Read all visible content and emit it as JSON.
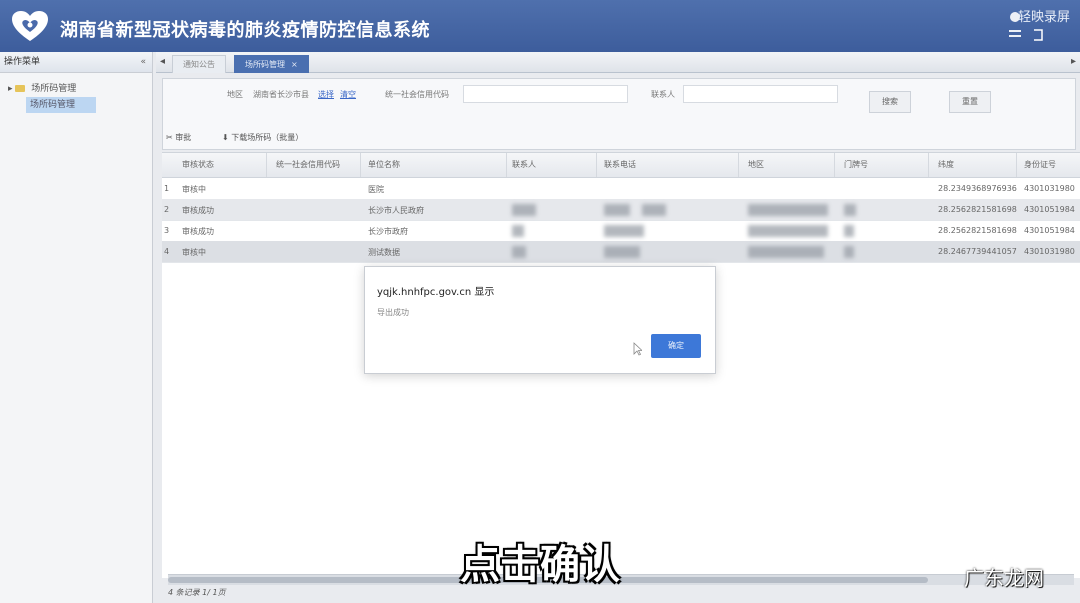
{
  "header": {
    "title": "湖南省新型冠状病毒的肺炎疫情防控信息系统",
    "recorder_text": "轻映录屏"
  },
  "sidebar": {
    "title": "操作菜单",
    "collapse": "«",
    "tree": {
      "parent": "场所码管理",
      "child": "场所码管理"
    }
  },
  "tabs": [
    {
      "label": "通知公告"
    },
    {
      "label": "场所码管理",
      "close": "×"
    }
  ],
  "tab_arrows": {
    "left": "◂",
    "right": "▸"
  },
  "filters": {
    "region_label": "地区",
    "region_value": "湖南省长沙市县",
    "select_link": "选择",
    "clear_link": "清空",
    "credit_code_label": "统一社会信用代码",
    "contact_label": "联系人",
    "search_button": "搜索",
    "reset_button": "重置"
  },
  "toolbar": {
    "audit_label": "审批",
    "download_label": "下载场所码（批量）"
  },
  "grid": {
    "columns": [
      "审核状态",
      "统一社会信用代码",
      "单位名称",
      "联系人",
      "联系电话",
      "地区",
      "门牌号",
      "纬度",
      "身份证号"
    ],
    "rows": [
      {
        "no": "1",
        "status": "审核中",
        "unit": "医院",
        "contact": "",
        "phone": "",
        "lat": "",
        "id": ""
      },
      {
        "no": "2",
        "status": "审核成功",
        "unit": "长沙市人民政府",
        "contact": "",
        "phone": "",
        "lat": "28.2562821581698",
        "id": "4301051984"
      },
      {
        "no": "3",
        "status": "审核成功",
        "unit": "长沙市政府",
        "contact": "",
        "phone": "",
        "lat": "28.2562821581698",
        "id": "4301051984"
      },
      {
        "no": "4",
        "status": "审核中",
        "unit": "测试数据",
        "contact": "",
        "phone": "",
        "lat": "28.2467739441057",
        "id": "4301031980"
      }
    ],
    "row1_lat": "28.2349368976936",
    "row1_id": "4301031980",
    "pager": "4 条记录 1/ 1页"
  },
  "dialog": {
    "title": "yqjk.hnhfpc.gov.cn 显示",
    "message": "导出成功",
    "ok_button": "确定"
  },
  "overlay": {
    "subtitle": "点击确认",
    "watermark": "广东龙网"
  },
  "colors": {
    "header_bg": "#4a6aab",
    "tab_active": "#4a6fb0",
    "ok_button": "#3d78d8"
  }
}
